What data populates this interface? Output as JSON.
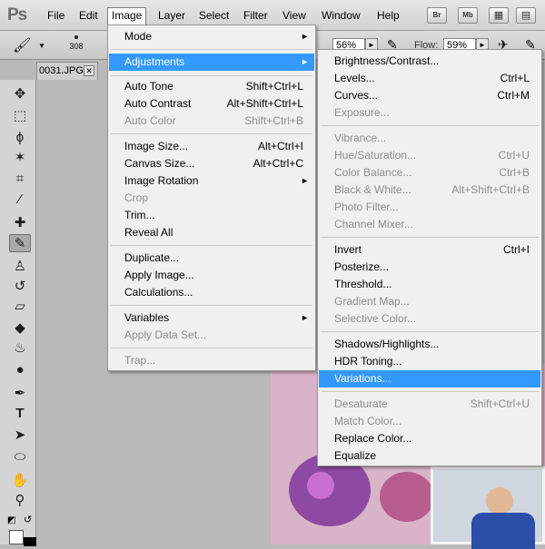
{
  "app": {
    "logo": "Ps"
  },
  "menubar": {
    "items": [
      "File",
      "Edit",
      "Image",
      "Layer",
      "Select",
      "Filter",
      "View",
      "Window",
      "Help"
    ],
    "app_buttons": [
      "Br",
      "Mb"
    ]
  },
  "options_bar": {
    "brush_size": "308",
    "opacity_value": "56%",
    "flow_label": "Flow:",
    "flow_value": "59%"
  },
  "document_tab": {
    "title": "0031.JPG",
    "close": "✕"
  },
  "image_menu": {
    "items": [
      {
        "label": "Mode",
        "submenu": "►"
      },
      {
        "label": "Adjustments",
        "submenu": "►"
      },
      {
        "label": "Auto Tone",
        "shortcut": "Shift+Ctrl+L"
      },
      {
        "label": "Auto Contrast",
        "shortcut": "Alt+Shift+Ctrl+L"
      },
      {
        "label": "Auto Color",
        "shortcut": "Shift+Ctrl+B"
      },
      {
        "label": "Image Size...",
        "shortcut": "Alt+Ctrl+I"
      },
      {
        "label": "Canvas Size...",
        "shortcut": "Alt+Ctrl+C"
      },
      {
        "label": "Image Rotation",
        "submenu": "►"
      },
      {
        "label": "Crop"
      },
      {
        "label": "Trim..."
      },
      {
        "label": "Reveal All"
      },
      {
        "label": "Duplicate..."
      },
      {
        "label": "Apply Image..."
      },
      {
        "label": "Calculations..."
      },
      {
        "label": "Variables",
        "submenu": "►"
      },
      {
        "label": "Apply Data Set..."
      },
      {
        "label": "Trap..."
      }
    ]
  },
  "adjustments_menu": {
    "items": [
      {
        "label": "Brightness/Contrast..."
      },
      {
        "label": "Levels...",
        "shortcut": "Ctrl+L"
      },
      {
        "label": "Curves...",
        "shortcut": "Ctrl+M"
      },
      {
        "label": "Exposure..."
      },
      {
        "label": "Vibrance..."
      },
      {
        "label": "Hue/Saturation...",
        "shortcut": "Ctrl+U"
      },
      {
        "label": "Color Balance...",
        "shortcut": "Ctrl+B"
      },
      {
        "label": "Black & White...",
        "shortcut": "Alt+Shift+Ctrl+B"
      },
      {
        "label": "Photo Filter..."
      },
      {
        "label": "Channel Mixer..."
      },
      {
        "label": "Invert",
        "shortcut": "Ctrl+I"
      },
      {
        "label": "Posterize..."
      },
      {
        "label": "Threshold..."
      },
      {
        "label": "Gradient Map..."
      },
      {
        "label": "Selective Color..."
      },
      {
        "label": "Shadows/Highlights..."
      },
      {
        "label": "HDR Toning..."
      },
      {
        "label": "Variations..."
      },
      {
        "label": "Desaturate",
        "shortcut": "Shift+Ctrl+U"
      },
      {
        "label": "Match Color..."
      },
      {
        "label": "Replace Color..."
      },
      {
        "label": "Equalize"
      }
    ]
  },
  "colors": {
    "highlight": "#3399ff",
    "disabled_text": "#8d8d8d",
    "menu_bg": "#f0f0f0"
  }
}
